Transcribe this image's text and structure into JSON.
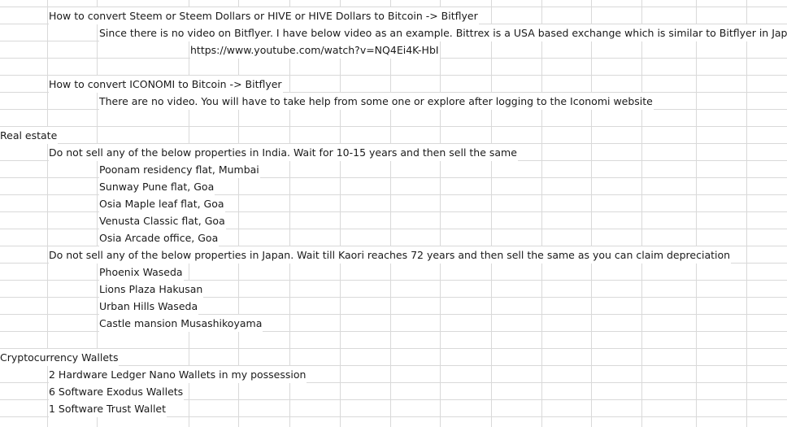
{
  "rows": [
    {
      "col": "b",
      "text": "How to convert Steem or Steem Dollars or HIVE or HIVE Dollars to Bitcoin -> Bitflyer"
    },
    {
      "col": "c",
      "text": "Since there is no video on Bitflyer. I have below video as an example. Bittrex is a USA based exchange which is similar to Bitflyer in Japan"
    },
    {
      "col": "d",
      "text": "https://www.youtube.com/watch?v=NQ4Ei4K-HbI"
    },
    {
      "col": "",
      "text": ""
    },
    {
      "col": "b",
      "text": "How to convert ICONOMI to Bitcoin -> Bitflyer"
    },
    {
      "col": "c",
      "text": "There are no video. You will have to take help from some one or explore after logging to the Iconomi website"
    },
    {
      "col": "",
      "text": ""
    },
    {
      "col": "a",
      "text": "Real estate"
    },
    {
      "col": "b",
      "text": "Do not sell any of the below properties in India. Wait for 10-15 years and then sell the same"
    },
    {
      "col": "c",
      "text": "Poonam residency flat, Mumbai"
    },
    {
      "col": "c",
      "text": "Sunway Pune flat, Goa"
    },
    {
      "col": "c",
      "text": "Osia Maple leaf flat, Goa"
    },
    {
      "col": "c",
      "text": "Venusta Classic flat, Goa"
    },
    {
      "col": "c",
      "text": "Osia Arcade office, Goa"
    },
    {
      "col": "b",
      "text": "Do not sell any of the below properties in Japan. Wait till Kaori reaches 72 years and then sell the same as you can claim depreciation"
    },
    {
      "col": "c",
      "text": "Phoenix Waseda"
    },
    {
      "col": "c",
      "text": "Lions Plaza Hakusan"
    },
    {
      "col": "c",
      "text": "Urban Hills Waseda"
    },
    {
      "col": "c",
      "text": "Castle mansion Musashikoyama"
    },
    {
      "col": "",
      "text": ""
    },
    {
      "col": "a",
      "text": "Cryptocurrency Wallets"
    },
    {
      "col": "b",
      "text": "2 Hardware Ledger Nano Wallets in my possession"
    },
    {
      "col": "b",
      "text": "6 Software Exodus Wallets"
    },
    {
      "col": "b",
      "text": "1 Software Trust Wallet"
    },
    {
      "col": "",
      "text": ""
    }
  ]
}
